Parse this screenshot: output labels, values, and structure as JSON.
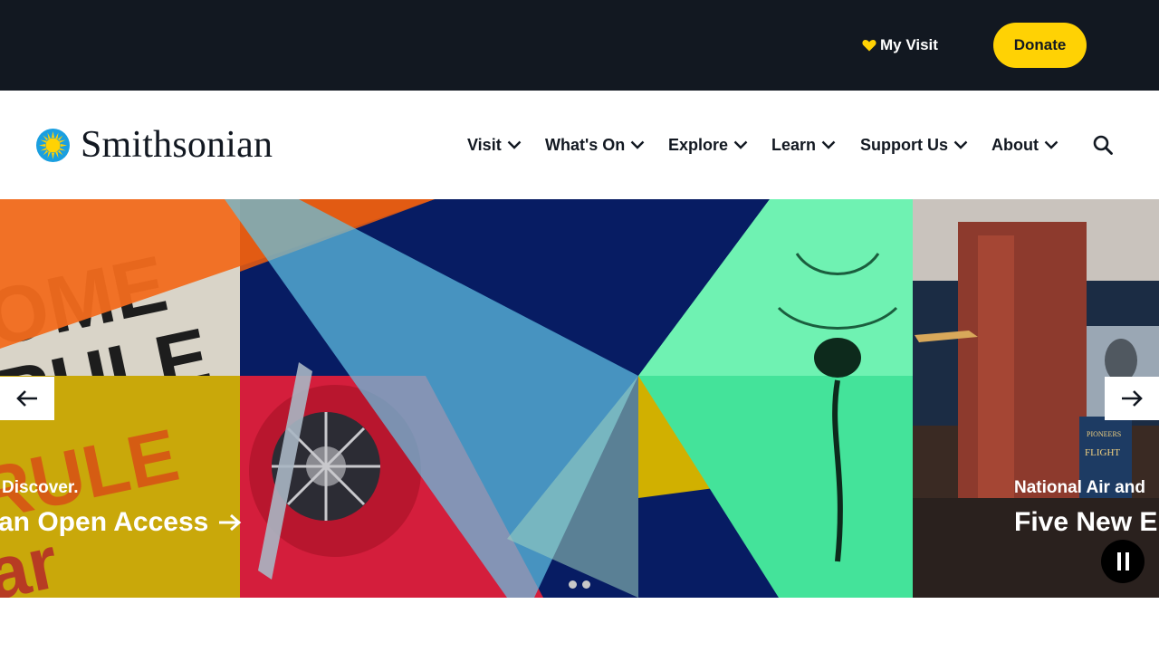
{
  "utility": {
    "my_visit_label": "My Visit",
    "donate_label": "Donate"
  },
  "brand": {
    "name": "Smithsonian",
    "sun_color": "#ffd204",
    "sun_ring_color": "#1a9fe0"
  },
  "nav": {
    "items": [
      {
        "label": "Visit"
      },
      {
        "label": "What's On"
      },
      {
        "label": "Explore"
      },
      {
        "label": "Learn"
      },
      {
        "label": "Support Us"
      },
      {
        "label": "About"
      }
    ],
    "search_icon": "search-icon"
  },
  "carousel": {
    "slides": [
      {
        "kicker": "Discover.",
        "title": "an Open Access"
      },
      {
        "kicker": "National Air and",
        "title": "Five New E"
      }
    ],
    "dot_count": 2,
    "prev_icon": "arrow-left-icon",
    "next_icon": "arrow-right-icon",
    "pause_icon": "pause-icon"
  },
  "colors": {
    "utility_bg": "#121821",
    "accent": "#ffd204",
    "text_dark": "#121821"
  }
}
